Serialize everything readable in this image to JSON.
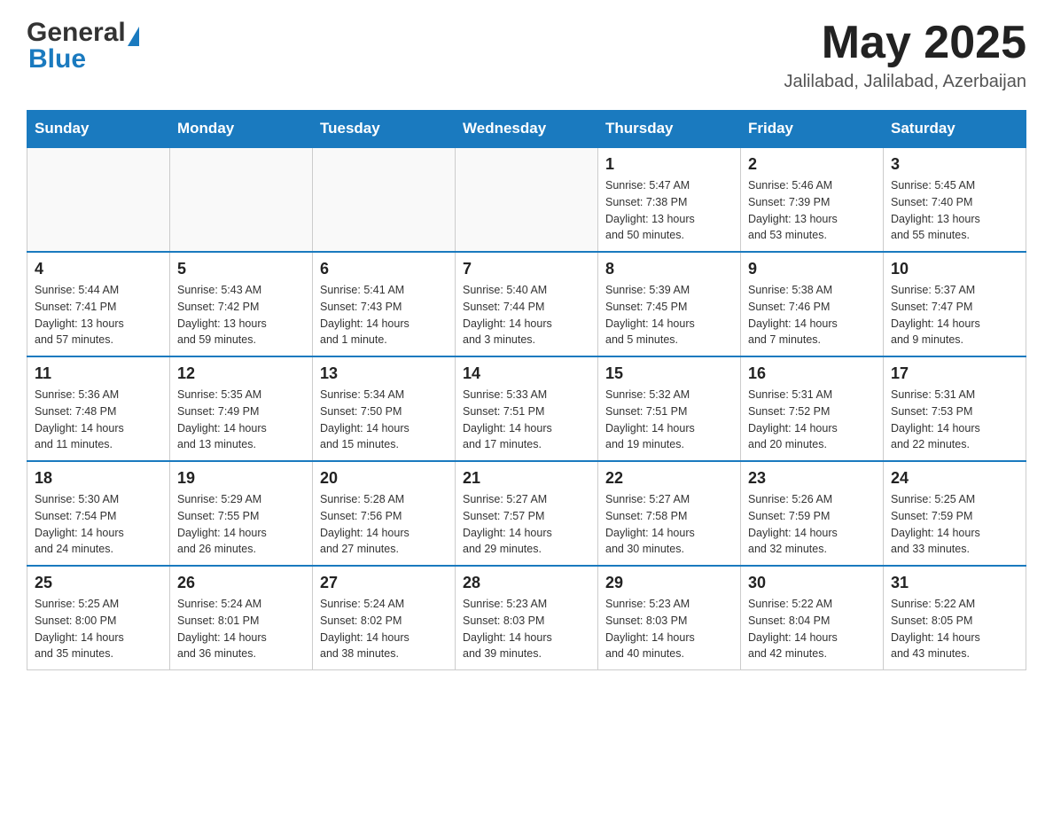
{
  "header": {
    "title": "May 2025",
    "location": "Jalilabad, Jalilabad, Azerbaijan"
  },
  "days_of_week": [
    "Sunday",
    "Monday",
    "Tuesday",
    "Wednesday",
    "Thursday",
    "Friday",
    "Saturday"
  ],
  "weeks": [
    {
      "days": [
        {
          "num": "",
          "info": ""
        },
        {
          "num": "",
          "info": ""
        },
        {
          "num": "",
          "info": ""
        },
        {
          "num": "",
          "info": ""
        },
        {
          "num": "1",
          "info": "Sunrise: 5:47 AM\nSunset: 7:38 PM\nDaylight: 13 hours\nand 50 minutes."
        },
        {
          "num": "2",
          "info": "Sunrise: 5:46 AM\nSunset: 7:39 PM\nDaylight: 13 hours\nand 53 minutes."
        },
        {
          "num": "3",
          "info": "Sunrise: 5:45 AM\nSunset: 7:40 PM\nDaylight: 13 hours\nand 55 minutes."
        }
      ]
    },
    {
      "days": [
        {
          "num": "4",
          "info": "Sunrise: 5:44 AM\nSunset: 7:41 PM\nDaylight: 13 hours\nand 57 minutes."
        },
        {
          "num": "5",
          "info": "Sunrise: 5:43 AM\nSunset: 7:42 PM\nDaylight: 13 hours\nand 59 minutes."
        },
        {
          "num": "6",
          "info": "Sunrise: 5:41 AM\nSunset: 7:43 PM\nDaylight: 14 hours\nand 1 minute."
        },
        {
          "num": "7",
          "info": "Sunrise: 5:40 AM\nSunset: 7:44 PM\nDaylight: 14 hours\nand 3 minutes."
        },
        {
          "num": "8",
          "info": "Sunrise: 5:39 AM\nSunset: 7:45 PM\nDaylight: 14 hours\nand 5 minutes."
        },
        {
          "num": "9",
          "info": "Sunrise: 5:38 AM\nSunset: 7:46 PM\nDaylight: 14 hours\nand 7 minutes."
        },
        {
          "num": "10",
          "info": "Sunrise: 5:37 AM\nSunset: 7:47 PM\nDaylight: 14 hours\nand 9 minutes."
        }
      ]
    },
    {
      "days": [
        {
          "num": "11",
          "info": "Sunrise: 5:36 AM\nSunset: 7:48 PM\nDaylight: 14 hours\nand 11 minutes."
        },
        {
          "num": "12",
          "info": "Sunrise: 5:35 AM\nSunset: 7:49 PM\nDaylight: 14 hours\nand 13 minutes."
        },
        {
          "num": "13",
          "info": "Sunrise: 5:34 AM\nSunset: 7:50 PM\nDaylight: 14 hours\nand 15 minutes."
        },
        {
          "num": "14",
          "info": "Sunrise: 5:33 AM\nSunset: 7:51 PM\nDaylight: 14 hours\nand 17 minutes."
        },
        {
          "num": "15",
          "info": "Sunrise: 5:32 AM\nSunset: 7:51 PM\nDaylight: 14 hours\nand 19 minutes."
        },
        {
          "num": "16",
          "info": "Sunrise: 5:31 AM\nSunset: 7:52 PM\nDaylight: 14 hours\nand 20 minutes."
        },
        {
          "num": "17",
          "info": "Sunrise: 5:31 AM\nSunset: 7:53 PM\nDaylight: 14 hours\nand 22 minutes."
        }
      ]
    },
    {
      "days": [
        {
          "num": "18",
          "info": "Sunrise: 5:30 AM\nSunset: 7:54 PM\nDaylight: 14 hours\nand 24 minutes."
        },
        {
          "num": "19",
          "info": "Sunrise: 5:29 AM\nSunset: 7:55 PM\nDaylight: 14 hours\nand 26 minutes."
        },
        {
          "num": "20",
          "info": "Sunrise: 5:28 AM\nSunset: 7:56 PM\nDaylight: 14 hours\nand 27 minutes."
        },
        {
          "num": "21",
          "info": "Sunrise: 5:27 AM\nSunset: 7:57 PM\nDaylight: 14 hours\nand 29 minutes."
        },
        {
          "num": "22",
          "info": "Sunrise: 5:27 AM\nSunset: 7:58 PM\nDaylight: 14 hours\nand 30 minutes."
        },
        {
          "num": "23",
          "info": "Sunrise: 5:26 AM\nSunset: 7:59 PM\nDaylight: 14 hours\nand 32 minutes."
        },
        {
          "num": "24",
          "info": "Sunrise: 5:25 AM\nSunset: 7:59 PM\nDaylight: 14 hours\nand 33 minutes."
        }
      ]
    },
    {
      "days": [
        {
          "num": "25",
          "info": "Sunrise: 5:25 AM\nSunset: 8:00 PM\nDaylight: 14 hours\nand 35 minutes."
        },
        {
          "num": "26",
          "info": "Sunrise: 5:24 AM\nSunset: 8:01 PM\nDaylight: 14 hours\nand 36 minutes."
        },
        {
          "num": "27",
          "info": "Sunrise: 5:24 AM\nSunset: 8:02 PM\nDaylight: 14 hours\nand 38 minutes."
        },
        {
          "num": "28",
          "info": "Sunrise: 5:23 AM\nSunset: 8:03 PM\nDaylight: 14 hours\nand 39 minutes."
        },
        {
          "num": "29",
          "info": "Sunrise: 5:23 AM\nSunset: 8:03 PM\nDaylight: 14 hours\nand 40 minutes."
        },
        {
          "num": "30",
          "info": "Sunrise: 5:22 AM\nSunset: 8:04 PM\nDaylight: 14 hours\nand 42 minutes."
        },
        {
          "num": "31",
          "info": "Sunrise: 5:22 AM\nSunset: 8:05 PM\nDaylight: 14 hours\nand 43 minutes."
        }
      ]
    }
  ]
}
